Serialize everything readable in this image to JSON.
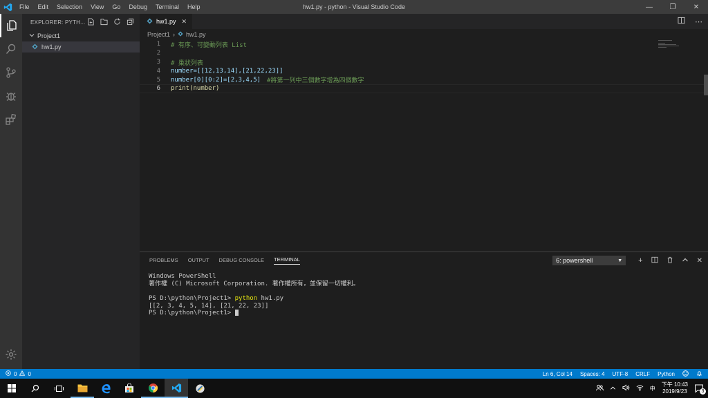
{
  "window": {
    "title": "hw1.py - python - Visual Studio Code",
    "menu": [
      "File",
      "Edit",
      "Selection",
      "View",
      "Go",
      "Debug",
      "Terminal",
      "Help"
    ]
  },
  "sidebar": {
    "header": "EXPLORER: PYTH...",
    "folder": "Project1",
    "file": "hw1.py"
  },
  "editor": {
    "tab_label": "hw1.py",
    "breadcrumb": [
      "Project1",
      "hw1.py"
    ],
    "lines": [
      {
        "num": "1",
        "text": "# 有序、可變動列表 List"
      },
      {
        "num": "2",
        "text": ""
      },
      {
        "num": "3",
        "text": "# 巢狀列表"
      },
      {
        "num": "4",
        "text": "number=[[12,13,14],[21,22,23]]"
      },
      {
        "num": "5",
        "text": "number[0][0:2]=[2,3,4,5]",
        "comment": "#將第一列中三個數字增為四個數字"
      },
      {
        "num": "6",
        "text": "print(number)"
      }
    ]
  },
  "panel": {
    "tabs": [
      "PROBLEMS",
      "OUTPUT",
      "DEBUG CONSOLE",
      "TERMINAL"
    ],
    "active_tab": "TERMINAL",
    "terminal_select": "6: powershell",
    "terminal_lines": [
      "Windows PowerShell",
      "著作權 (C) Microsoft Corporation. 著作權所有，並保留一切權利。",
      "",
      {
        "prompt": "PS D:\\python\\Project1> ",
        "cmd": "python",
        "args": " hw1.py"
      },
      "[[2, 3, 4, 5, 14], [21, 22, 23]]",
      {
        "prompt": "PS D:\\python\\Project1> ",
        "cursor": true
      }
    ]
  },
  "statusbar": {
    "errors": "0",
    "warnings": "0",
    "position": "Ln 6, Col 14",
    "spaces": "Spaces: 4",
    "encoding": "UTF-8",
    "eol": "CRLF",
    "language": "Python"
  },
  "taskbar": {
    "time": "下午 10:43",
    "date": "2019/9/23",
    "ime": "中",
    "notifications": "3"
  }
}
